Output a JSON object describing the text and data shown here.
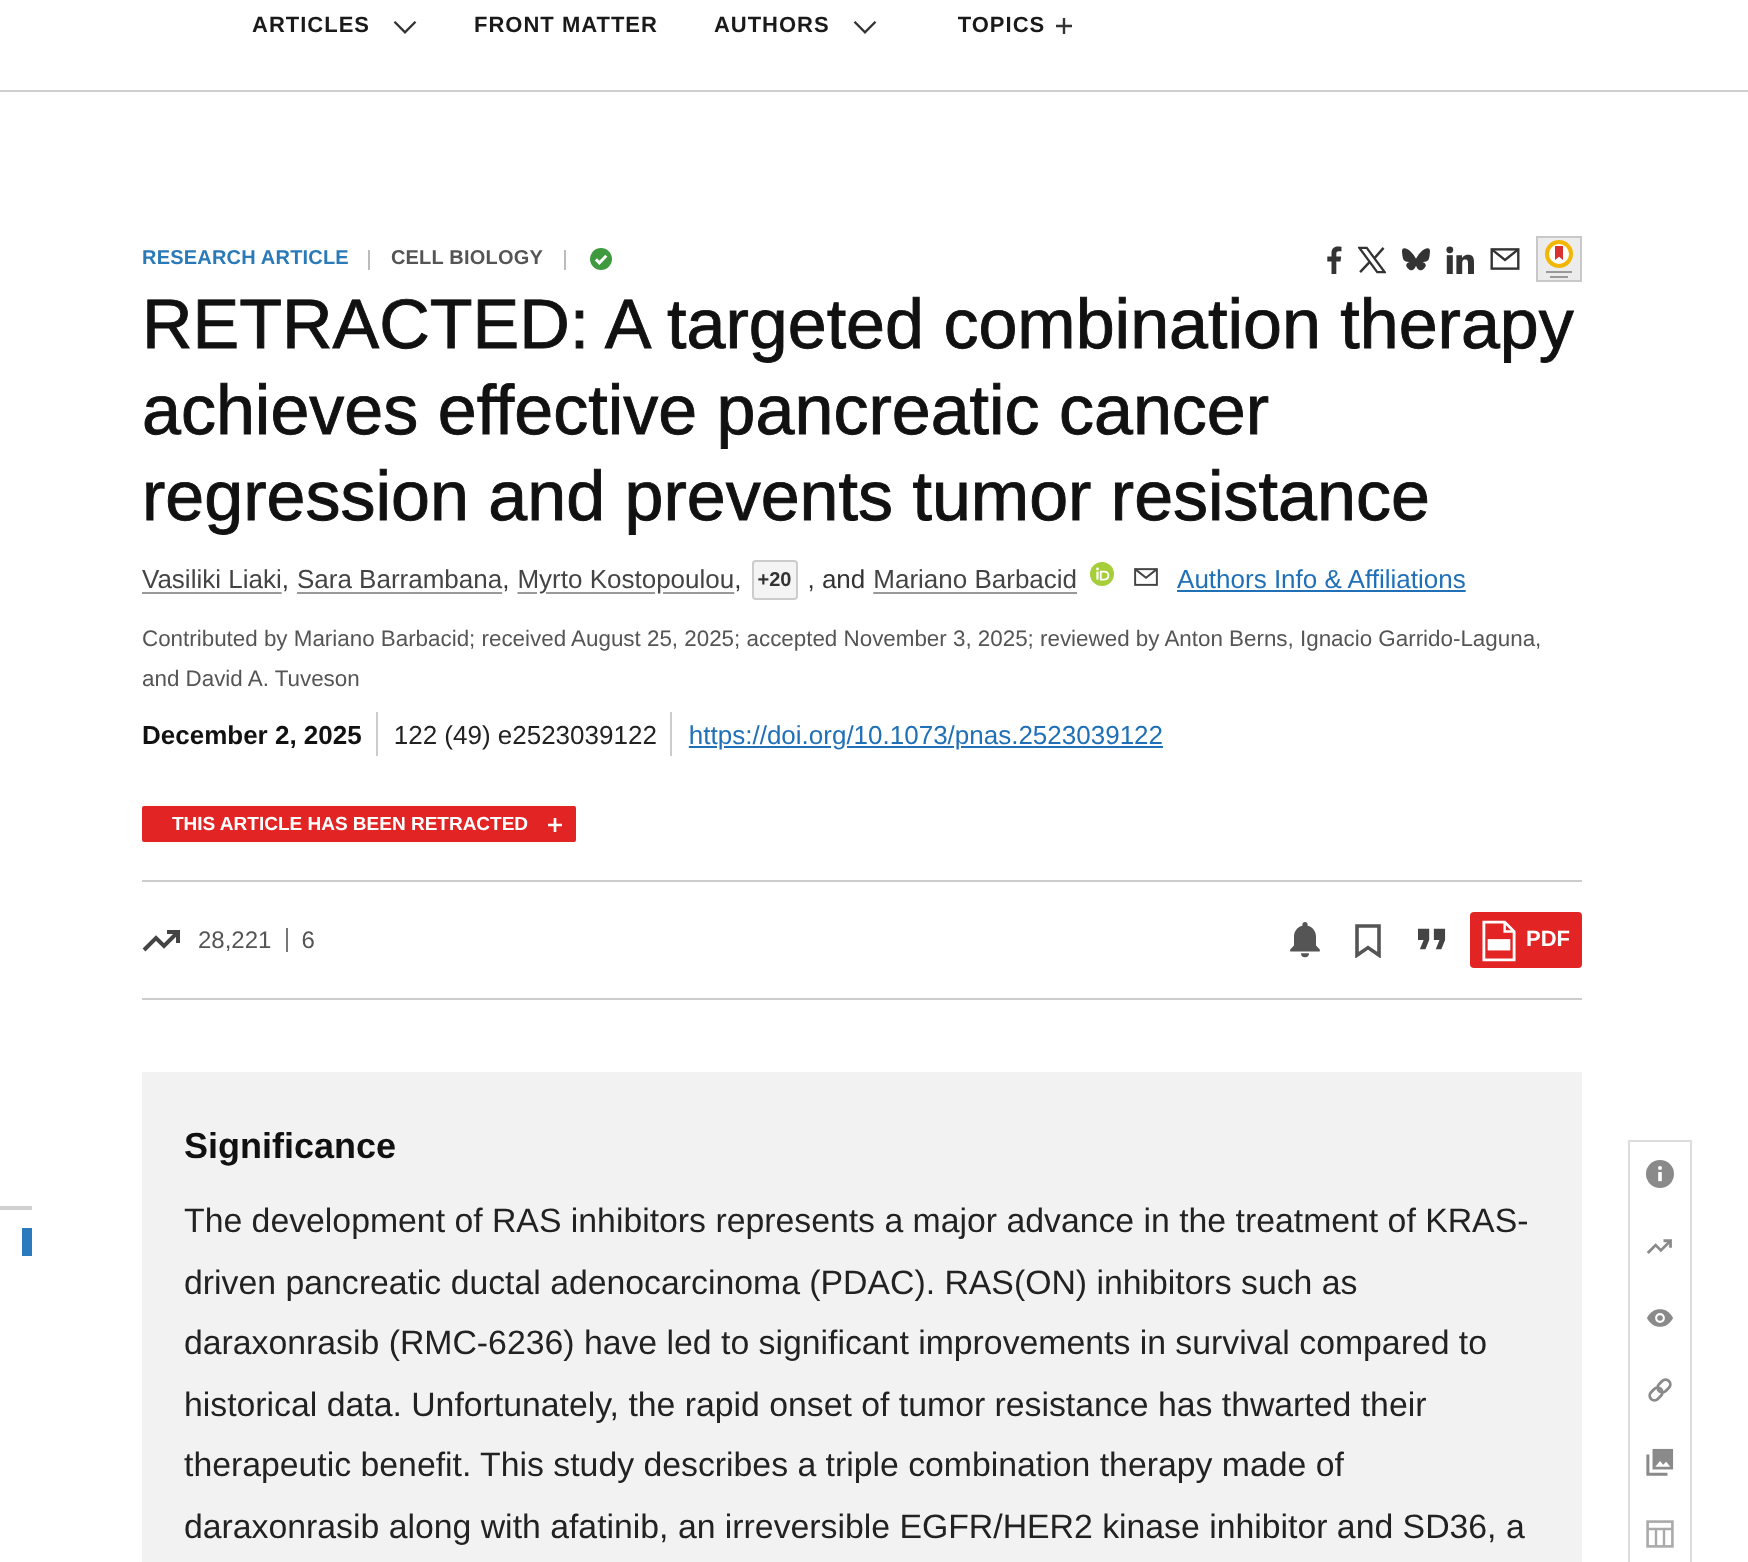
{
  "nav": [
    {
      "label": "ARTICLES",
      "kind": "dropdown"
    },
    {
      "label": "FRONT MATTER",
      "kind": "link"
    },
    {
      "label": "AUTHORS",
      "kind": "dropdown"
    },
    {
      "label": "TOPICS",
      "kind": "expand"
    }
  ],
  "article": {
    "type": "RESEARCH ARTICLE",
    "subject": "CELL BIOLOGY",
    "title": "RETRACTED: A targeted combination therapy achieves effective pancreatic cancer regression and prevents tumor resistance",
    "authors": [
      {
        "name": "Vasiliki Liaki",
        "separator": ","
      },
      {
        "name": "Sara Barrambana",
        "separator": ","
      },
      {
        "name": "Myrto Kostopoulou",
        "separator": ","
      }
    ],
    "more_authors": "+20",
    "conjunction": ", and",
    "last_author": "Mariano Barbacid",
    "affiliations_link": "Authors Info & Affiliations",
    "contribution": "Contributed by Mariano Barbacid; received August 25, 2025; accepted November 3, 2025; reviewed by Anton Berns, Ignacio Garrido-Laguna, and David A. Tuveson",
    "date": "December 2, 2025",
    "citation": "122 (49) e2523039122",
    "doi": "https://doi.org/10.1073/pnas.2523039122",
    "retraction_notice": "THIS ARTICLE HAS BEEN RETRACTED"
  },
  "metrics": {
    "views": "28,221",
    "citations": "6"
  },
  "pdf_button": "PDF",
  "significance": {
    "heading": "Significance",
    "text": "The development of RAS inhibitors represents a major advance in the treatment of KRAS-driven pancreatic ductal adenocarcinoma (PDAC). RAS(ON) inhibitors such as daraxonrasib (RMC-6236) have led to significant improvements in survival compared to historical data. Unfortunately, the rapid onset of tumor resistance has thwarted their therapeutic benefit. This study describes a triple combination therapy made of daraxonrasib along with afatinib, an irreversible EGFR/HER2 kinase inhibitor and SD36, a"
  }
}
